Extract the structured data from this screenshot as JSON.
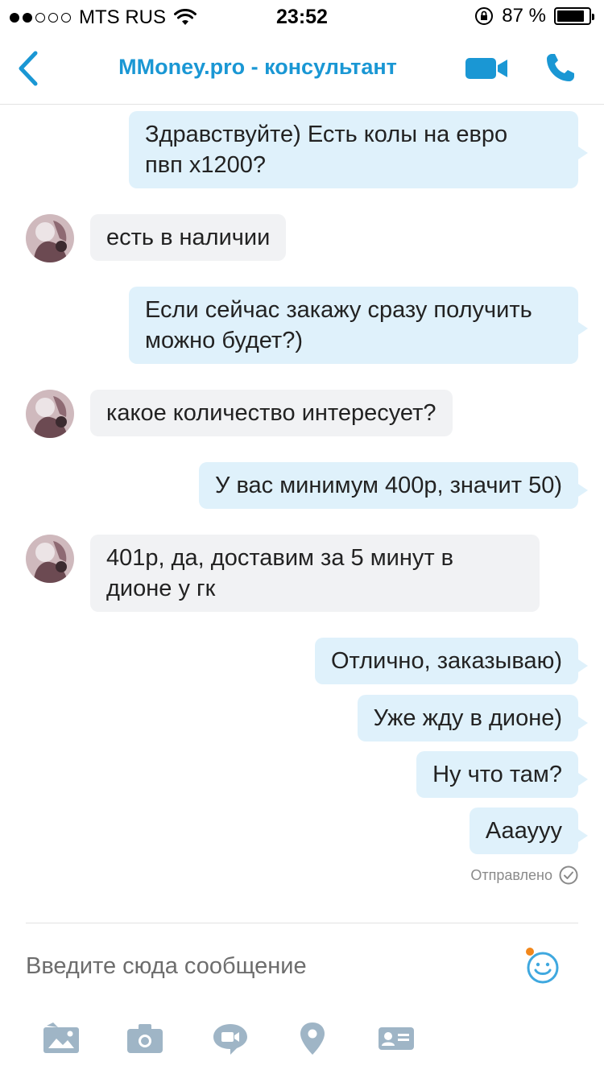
{
  "status_bar": {
    "carrier": "MTS RUS",
    "time": "23:52",
    "battery_text": "87 %",
    "battery_level": 0.87
  },
  "header": {
    "title": "MMoney.pro - консультант",
    "back_icon": "chevron-left-icon",
    "video_icon": "video-camera-icon",
    "call_icon": "phone-icon",
    "accent_color": "#1a97d4"
  },
  "messages": [
    {
      "direction": "out",
      "lines": [
        "Здравствуйте) Есть колы на евро",
        "пвп х1200?"
      ]
    },
    {
      "direction": "in",
      "lines": [
        "есть в наличии"
      ]
    },
    {
      "direction": "out",
      "lines": [
        "Если сейчас закажу сразу получить",
        "можно будет?)"
      ]
    },
    {
      "direction": "in",
      "lines": [
        "какое количество интересует?"
      ]
    },
    {
      "direction": "out",
      "lines": [
        "У вас минимум 400р, значит 50)"
      ]
    },
    {
      "direction": "in",
      "lines": [
        "401р, да, доставим за 5 минут в",
        "дионе у гк"
      ]
    },
    {
      "direction": "out",
      "lines": [
        "Отлично, заказываю)"
      ]
    },
    {
      "direction": "out",
      "lines": [
        "Уже жду в дионе)"
      ]
    },
    {
      "direction": "out",
      "lines": [
        "Ну что там?"
      ]
    },
    {
      "direction": "out",
      "lines": [
        "Аааууу"
      ]
    }
  ],
  "delivery_status": "Отправлено",
  "composer": {
    "placeholder": "Введите сюда сообщение",
    "emoji_icon": "smiley-icon"
  },
  "toolbar": {
    "icons": [
      "photo-gallery-icon",
      "camera-icon",
      "video-message-icon",
      "location-pin-icon",
      "contact-card-icon"
    ]
  },
  "colors": {
    "outgoing_bubble": "#dff1fb",
    "incoming_bubble": "#f1f2f4",
    "icon_gray": "#9fb5c6"
  }
}
